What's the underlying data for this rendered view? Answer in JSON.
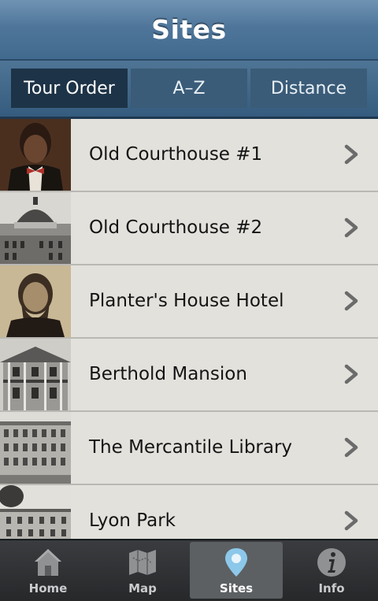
{
  "header": {
    "title": "Sites"
  },
  "segments": [
    {
      "label": "Tour Order",
      "active": true
    },
    {
      "label": "A–Z",
      "active": false
    },
    {
      "label": "Distance",
      "active": false
    }
  ],
  "sites": [
    {
      "name": "Old Courthouse #1",
      "thumb": "portrait-man-bowtie"
    },
    {
      "name": "Old Courthouse #2",
      "thumb": "domed-courthouse-photo"
    },
    {
      "name": "Planter's House Hotel",
      "thumb": "portrait-man-beard"
    },
    {
      "name": "Berthold Mansion",
      "thumb": "mansion-photo"
    },
    {
      "name": "The Mercantile Library",
      "thumb": "library-building-photo"
    },
    {
      "name": "Lyon Park",
      "thumb": "park-building-photo"
    }
  ],
  "tabs": [
    {
      "label": "Home",
      "icon": "home-icon",
      "active": false
    },
    {
      "label": "Map",
      "icon": "map-icon",
      "active": false
    },
    {
      "label": "Sites",
      "icon": "map-pin-icon",
      "active": true
    },
    {
      "label": "Info",
      "icon": "info-icon",
      "active": false
    }
  ],
  "colors": {
    "header": "#4f769a",
    "segment_active": "#1d3347",
    "list_bg": "#e3e1dc",
    "tabbar": "#2e3033"
  }
}
